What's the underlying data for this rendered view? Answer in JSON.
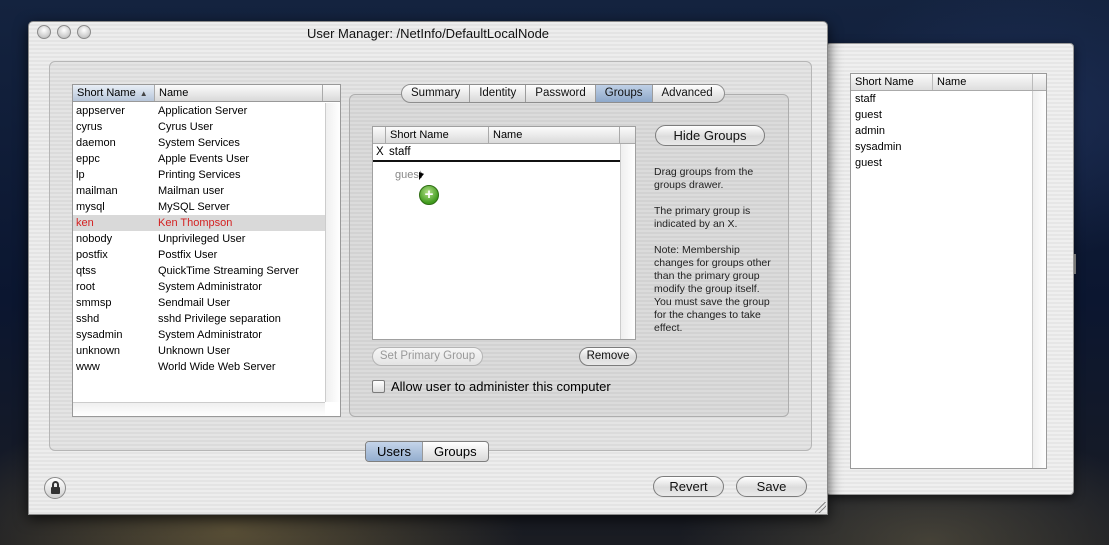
{
  "window": {
    "title": "User Manager: /NetInfo/DefaultLocalNode"
  },
  "user_list": {
    "columns": [
      "Short Name",
      "Name"
    ],
    "sort_indicator": "▲",
    "rows": [
      {
        "short": "appserver",
        "name": "Application Server"
      },
      {
        "short": "cyrus",
        "name": "Cyrus User"
      },
      {
        "short": "daemon",
        "name": "System Services"
      },
      {
        "short": "eppc",
        "name": "Apple Events User"
      },
      {
        "short": "lp",
        "name": "Printing Services"
      },
      {
        "short": "mailman",
        "name": "Mailman user"
      },
      {
        "short": "mysql",
        "name": "MySQL Server"
      },
      {
        "short": "ken",
        "name": "Ken Thompson"
      },
      {
        "short": "nobody",
        "name": "Unprivileged User"
      },
      {
        "short": "postfix",
        "name": "Postfix User"
      },
      {
        "short": "qtss",
        "name": "QuickTime Streaming Server"
      },
      {
        "short": "root",
        "name": "System Administrator"
      },
      {
        "short": "smmsp",
        "name": "Sendmail User"
      },
      {
        "short": "sshd",
        "name": "sshd Privilege separation"
      },
      {
        "short": "sysadmin",
        "name": "System Administrator"
      },
      {
        "short": "unknown",
        "name": "Unknown User"
      },
      {
        "short": "www",
        "name": "World Wide Web Server"
      }
    ],
    "selected_index": 7,
    "selected_color": "#d42222"
  },
  "tabs": [
    "Summary",
    "Identity",
    "Password",
    "Groups",
    "Advanced"
  ],
  "active_tab": "Groups",
  "groups_table": {
    "columns": [
      "",
      "Short Name",
      "Name"
    ],
    "rows": [
      {
        "primary": "X",
        "short": "staff",
        "name": ""
      }
    ],
    "drag_ghost": "guest"
  },
  "buttons": {
    "hide_groups": "Hide Groups",
    "set_primary_group": "Set Primary Group",
    "remove": "Remove",
    "revert": "Revert",
    "save": "Save"
  },
  "help_text": [
    "Drag groups from the groups drawer.",
    "The primary group is indicated by an X.",
    "Note:  Membership changes for groups other than the primary group modify the group itself.  You must save the group for the changes to take effect."
  ],
  "checkbox": {
    "label": "Allow user to administer this computer",
    "checked": false
  },
  "segmented": {
    "items": [
      "Users",
      "Groups"
    ],
    "active": "Users"
  },
  "drawer": {
    "columns": [
      "Short Name",
      "Name"
    ],
    "rows": [
      "staff",
      "guest",
      "admin",
      "sysadmin",
      "guest"
    ]
  },
  "icons": [
    "lock-icon",
    "add-cursor-icon",
    "sort-ascending-icon",
    "resize-grip-icon"
  ],
  "colors": {
    "active_segment": "#94aecf",
    "selection_text": "#d42222"
  }
}
